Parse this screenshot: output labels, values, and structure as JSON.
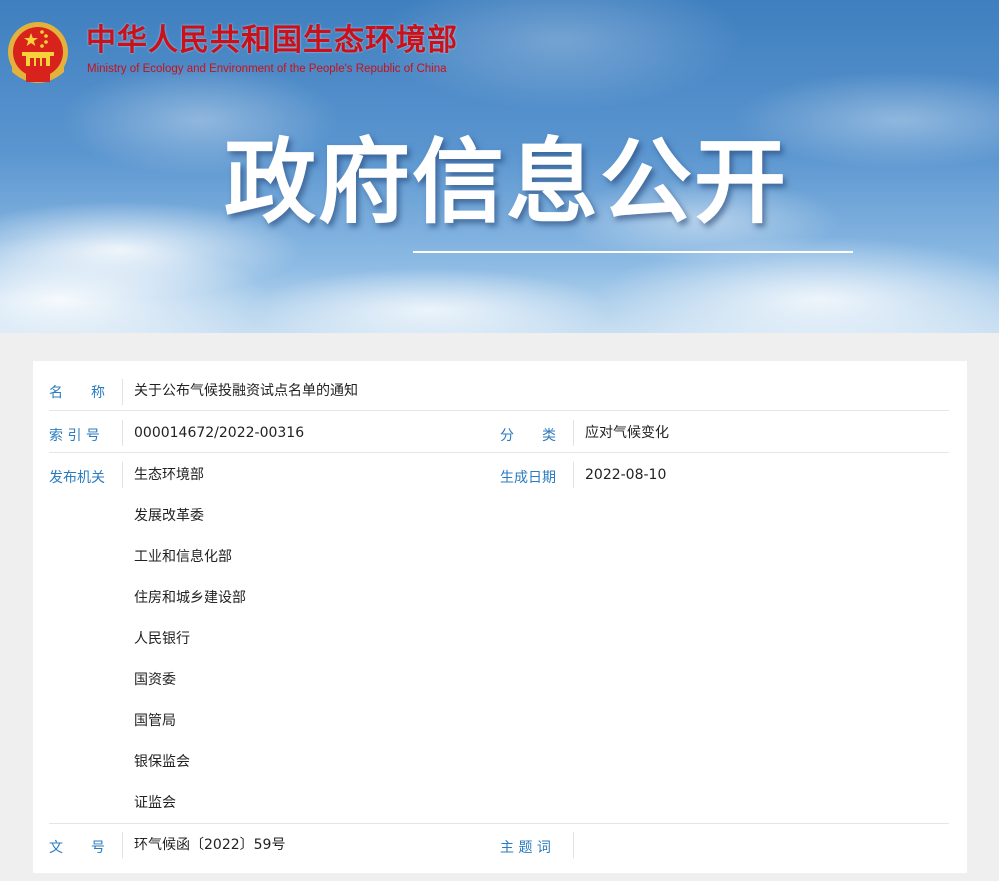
{
  "header": {
    "org_name_cn": "中华人民共和国生态环境部",
    "org_name_en": "Ministry of Ecology and Environment of the People's Republic of China",
    "page_title": "政府信息公开",
    "emblem_icon": "national-emblem-icon"
  },
  "info": {
    "name_label": "名　　称",
    "name_value": "关于公布气候投融资试点名单的通知",
    "index_label": "索 引 号",
    "index_value": "000014672/2022-00316",
    "category_label": "分　　类",
    "category_value": "应对气候变化",
    "issuer_label": "发布机关",
    "issuers": [
      "生态环境部",
      "发展改革委",
      "工业和信息化部",
      "住房和城乡建设部",
      "人民银行",
      "国资委",
      "国管局",
      "银保监会",
      "证监会"
    ],
    "date_label": "生成日期",
    "date_value": "2022-08-10",
    "doc_no_label": "文　　号",
    "doc_no_value": "环气候函〔2022〕59号",
    "keywords_label": "主 题 词",
    "keywords_value": ""
  },
  "colors": {
    "brand_red": "#c8111a",
    "label_blue": "#2a7bbf",
    "text": "#222222"
  }
}
